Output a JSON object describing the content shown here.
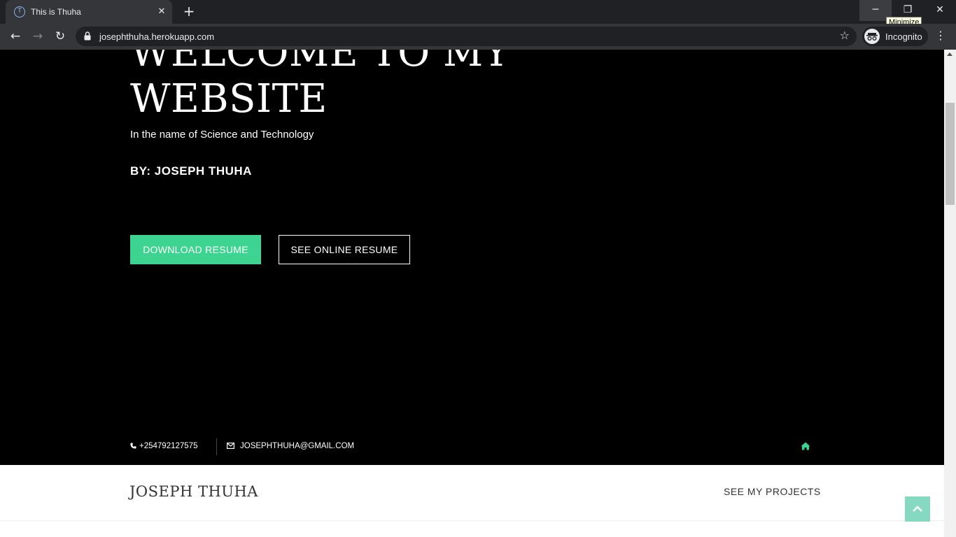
{
  "browser": {
    "tab_title": "This is Thuha",
    "url": "josephthuha.herokuapp.com",
    "incognito_label": "Incognito",
    "tooltip": "Minimize"
  },
  "hero": {
    "title": "WELCOME TO MY WEBSITE",
    "subtitle": "In the name of Science and Technology",
    "byline": "BY: JOSEPH THUHA",
    "download_button": "DOWNLOAD RESUME",
    "online_button": "SEE ONLINE RESUME"
  },
  "contact": {
    "phone": "+254792127575",
    "email": "JOSEPHTHUHA@GMAIL.COM"
  },
  "navbar": {
    "brand": "JOSEPH THUHA",
    "projects_link": "SEE MY PROJECTS"
  },
  "colors": {
    "accent": "#3cd490",
    "back_to_top": "#86d9c0",
    "chrome_dark": "#202124",
    "chrome_mid": "#35363a"
  },
  "icons": {
    "tab_favicon": "site-logo-icon",
    "back": "arrow-left-icon",
    "forward": "arrow-right-icon",
    "reload": "reload-icon",
    "lock": "lock-icon",
    "bookmark": "star-icon",
    "incognito": "incognito-icon",
    "menu": "kebab-menu-icon",
    "phone": "phone-icon",
    "email": "envelope-icon",
    "home": "home-icon",
    "back_to_top": "chevron-up-icon"
  }
}
